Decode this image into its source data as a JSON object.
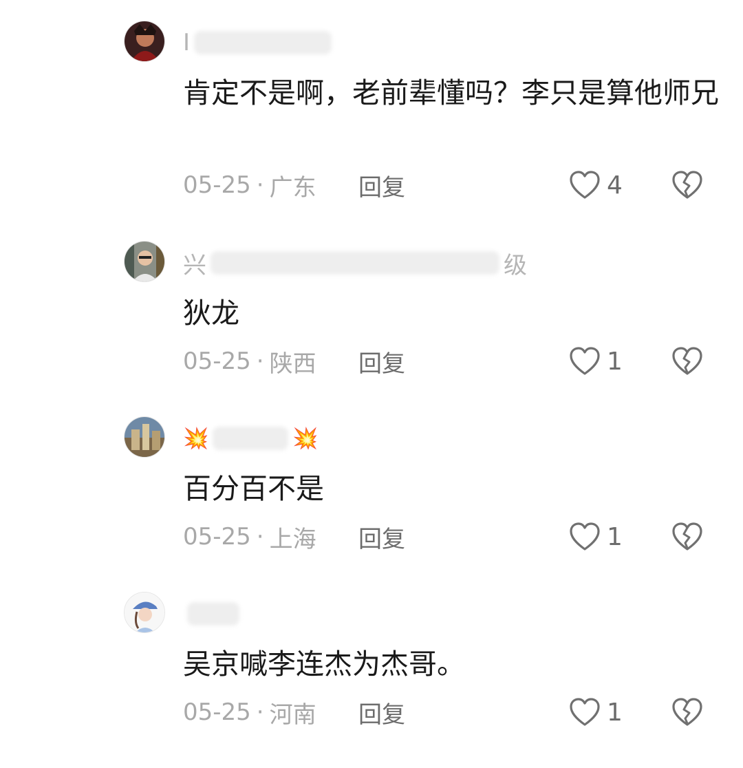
{
  "comments": [
    {
      "username_visible": "Ⅰ",
      "text": "肯定不是啊，老前辈懂吗？李只是算他师兄",
      "date": "05-25",
      "separator": "·",
      "location": "广东",
      "reply_label": "回复",
      "likes": "4"
    },
    {
      "username_visible": "兴",
      "username_suffix": "级",
      "text": "狄龙",
      "date": "05-25",
      "separator": "·",
      "location": "陕西",
      "reply_label": "回复",
      "likes": "1"
    },
    {
      "username_visible": "💥",
      "username_suffix": "💥",
      "text": "百分百不是",
      "date": "05-25",
      "separator": "·",
      "location": "上海",
      "reply_label": "回复",
      "likes": "1"
    },
    {
      "username_visible": "",
      "text": "吴京喊李连杰为杰哥。",
      "date": "05-25",
      "separator": "·",
      "location": "河南",
      "reply_label": "回复",
      "likes": "1"
    }
  ],
  "colors": {
    "text_primary": "#1a1a1a",
    "text_meta": "#a8a8a8",
    "text_action": "#6c6c6c",
    "icon_stroke": "#707070"
  }
}
